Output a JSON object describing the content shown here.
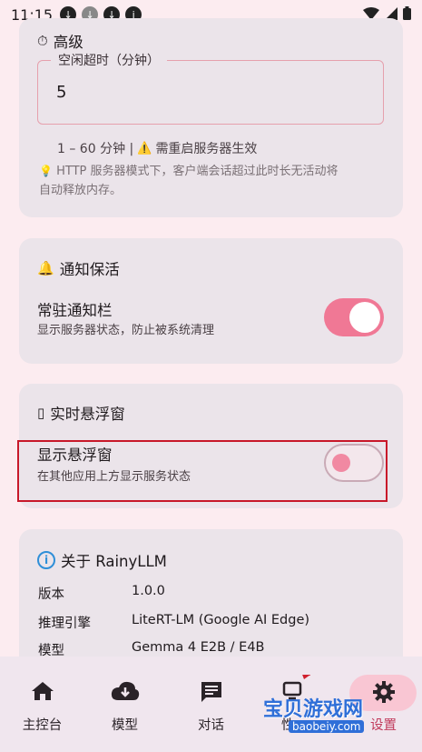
{
  "status": {
    "time": "11:15"
  },
  "advanced": {
    "icon": "⏱",
    "title": "高级",
    "field_label": "空闲超时（分钟）",
    "field_value": "5",
    "range_hint": "1 – 60 分钟 |",
    "warn_icon": "⚠️",
    "warn_text": "需重启服务器生效",
    "info_icon": "💡",
    "info_text_line1": "HTTP 服务器模式下，客户端会话超过此时长无活动将",
    "info_text_line2": "自动释放内存。"
  },
  "keepalive": {
    "icon": "🔔",
    "title": "通知保活",
    "row_title": "常驻通知栏",
    "row_sub": "显示服务器状态，防止被系统清理",
    "toggle_on": true
  },
  "floating": {
    "icon": "▯",
    "title": "实时悬浮窗",
    "row_title": "显示悬浮窗",
    "row_sub": "在其他应用上方显示服务状态",
    "toggle_on": false
  },
  "about": {
    "icon": "i",
    "title": "关于 RainyLLM",
    "rows": [
      {
        "label": "版本",
        "value": "1.0.0"
      },
      {
        "label": "推理引擎",
        "value": "LiteRT-LM (Google AI Edge)"
      },
      {
        "label": "模型",
        "value": "Gemma 4 E2B / E4B"
      }
    ]
  },
  "nav": {
    "items": [
      {
        "label": "主控台",
        "icon": "home-icon"
      },
      {
        "label": "模型",
        "icon": "cloud-download-icon"
      },
      {
        "label": "对话",
        "icon": "chat-icon"
      },
      {
        "label": "性",
        "icon": "monitor-icon"
      },
      {
        "label": "设置",
        "icon": "gear-icon"
      }
    ]
  },
  "watermark": {
    "text": "宝贝游戏网",
    "sub": "baobeiy.com"
  },
  "colors": {
    "accent": "#f07895",
    "highlight": "#c8182a",
    "card": "#ebe4ea",
    "background": "#fcecf0"
  }
}
